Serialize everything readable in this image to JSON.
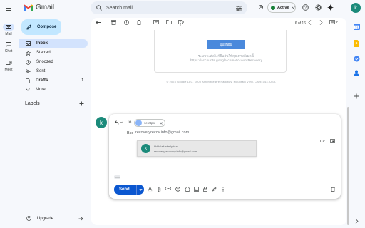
{
  "app": {
    "name": "Gmail",
    "brand_color": "#ea4335"
  },
  "rail": [
    {
      "label": "Mail",
      "active": true
    },
    {
      "label": "Chat",
      "active": false
    },
    {
      "label": "Meet",
      "active": false
    }
  ],
  "compose_label": "Compose",
  "nav": [
    {
      "label": "Inbox",
      "count": "",
      "active": true
    },
    {
      "label": "Starred",
      "count": "",
      "active": false
    },
    {
      "label": "Snoozed",
      "count": "",
      "active": false
    },
    {
      "label": "Sent",
      "count": "",
      "active": false
    },
    {
      "label": "Drafts",
      "count": "1",
      "active": false
    },
    {
      "label": "More",
      "count": "",
      "active": false
    }
  ],
  "labels_heading": "Labels",
  "upgrade_label": "Upgrade",
  "search": {
    "placeholder": "Search mail"
  },
  "status_label": "Active",
  "user_initial": "k",
  "pager_text": "6 of 16",
  "email": {
    "button_text": "ปุ่มยืนยัน",
    "line1": "ระบบจะส่งลิงก์ยืนยันให้คุณทางอีเมลนี้",
    "line2": "https://accounts.google.com/AccountRecovery",
    "footer": "© 2023 Google LLC, 1600 Amphitheatre Parkway, Mountain View, CA 94043, USA"
  },
  "reply": {
    "to_label": "To",
    "recipient": "seratpo",
    "bcc_label": "Bcc",
    "bcc_value": "recoveryrecov.info@gmail.com",
    "cc_label": "Cc",
    "suggestion": {
      "name": "kkkk-lalt akmlyrtsa",
      "email": "recoveryrecovery.info@gmail.com"
    },
    "send_label": "Send"
  },
  "accent_color": "#0b57d0"
}
